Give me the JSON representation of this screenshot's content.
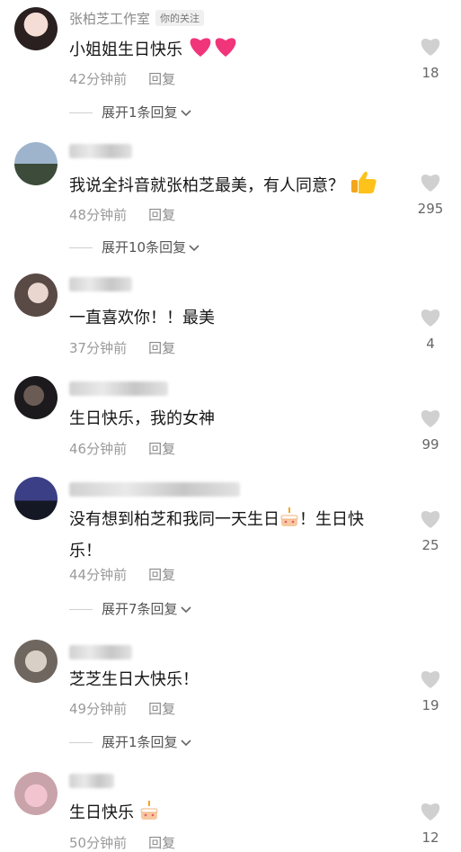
{
  "comments": [
    {
      "username": "张柏芝工作室",
      "tag": "你的关注",
      "text": "小姐姐生日快乐",
      "time": "42分钟前",
      "reply": "回复",
      "likes": "18",
      "expand": "展开1条回复"
    },
    {
      "username": "",
      "text": "我说全抖音就张柏芝最美，有人同意？",
      "time": "48分钟前",
      "reply": "回复",
      "likes": "295",
      "expand": "展开10条回复"
    },
    {
      "username": "",
      "text": "一直喜欢你！！最美",
      "time": "37分钟前",
      "reply": "回复",
      "likes": "4"
    },
    {
      "username": "",
      "text": "生日快乐，我的女神",
      "time": "46分钟前",
      "reply": "回复",
      "likes": "99"
    },
    {
      "username": "",
      "text_line1": "没有想到柏芝和我同一天生日",
      "text_line1_end": "！生日快",
      "text_line2": "乐！",
      "time": "44分钟前",
      "reply": "回复",
      "likes": "25",
      "expand": "展开7条回复"
    },
    {
      "username": "",
      "text": "芝芝生日大快乐！",
      "time": "49分钟前",
      "reply": "回复",
      "likes": "19",
      "expand": "展开1条回复"
    },
    {
      "username": "",
      "text": "生日快乐",
      "time": "50分钟前",
      "reply": "回复",
      "likes": "12"
    }
  ],
  "icons": {
    "like": "heart-icon",
    "heart_emoji": "pink-heart-emoji",
    "thumb_emoji": "thumbs-up-emoji",
    "cake_emoji": "birthday-cake-emoji",
    "expand": "chevron-down-icon"
  },
  "colors": {
    "heart_gray": "#d0d0d0",
    "pink": "#f0357a"
  }
}
